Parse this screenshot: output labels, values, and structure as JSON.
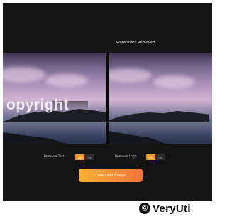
{
  "panes": {
    "right_title": "Watermark Removed",
    "left_watermark": "opyright"
  },
  "controls": {
    "remove_text": {
      "label": "Remove Text",
      "on": "On",
      "off": "Off"
    },
    "remove_logo": {
      "label": "Remove Logo",
      "on": "On",
      "off": "Off"
    }
  },
  "actions": {
    "download_label": "Download Image"
  },
  "brand": {
    "logo_glyph": "©",
    "name": "VeryUti"
  },
  "colors": {
    "accent": "#f49a24",
    "background": "#141414"
  }
}
